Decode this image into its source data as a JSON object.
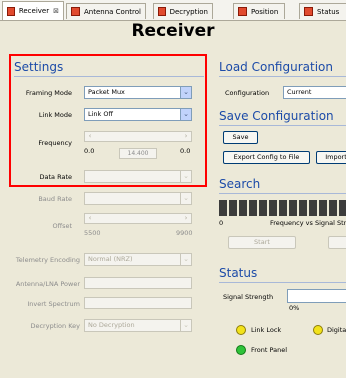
{
  "tabs": [
    {
      "label": "Receiver",
      "close": "⊠"
    },
    {
      "label": "Antenna Control"
    },
    {
      "label": "Decryption"
    },
    {
      "label": "Position"
    },
    {
      "label": "Status"
    }
  ],
  "page_title": "Receiver",
  "settings": {
    "heading": "Settings",
    "framing_mode": {
      "label": "Framing Mode",
      "value": "Packet Mux"
    },
    "link_mode": {
      "label": "Link Mode",
      "value": "Link Off"
    },
    "frequency": {
      "label": "Frequency",
      "min": "0.0",
      "current": "14.400",
      "max": "0.0"
    },
    "data_rate": {
      "label": "Data Rate",
      "value": ""
    },
    "baud_rate": {
      "label": "Baud Rate",
      "value": ""
    },
    "offset": {
      "label": "Offset",
      "min": "5500",
      "max": "9900"
    },
    "telemetry_encoding": {
      "label": "Telemetry Encoding",
      "value": "Normal (NRZ)"
    },
    "antenna_lna_power": {
      "label": "Antenna/LNA Power",
      "value": ""
    },
    "invert_spectrum": {
      "label": "Invert Spectrum",
      "value": ""
    },
    "decryption_key": {
      "label": "Decryption Key",
      "value": "No Decryption"
    }
  },
  "load_config": {
    "heading": "Load Configuration",
    "configuration_label": "Configuration",
    "configuration_value": "Current"
  },
  "save_config": {
    "heading": "Save Configuration",
    "save_button": "Save",
    "export_button": "Export Config to File",
    "import_button": "Import"
  },
  "search": {
    "heading": "Search",
    "axis_min": "0",
    "axis_caption": "Frequency vs Signal Str",
    "start_button": "Start"
  },
  "status": {
    "heading": "Status",
    "signal_strength_label": "Signal Strength",
    "signal_strength_value": "0%",
    "link_lock": "Link Lock",
    "digital": "Digita",
    "front_panel": "Front Panel"
  },
  "colors": {
    "heading": "#1c4ba8",
    "highlight": "#ff0000",
    "led_yellow": "#f2e21a",
    "led_green": "#2fc33a"
  }
}
